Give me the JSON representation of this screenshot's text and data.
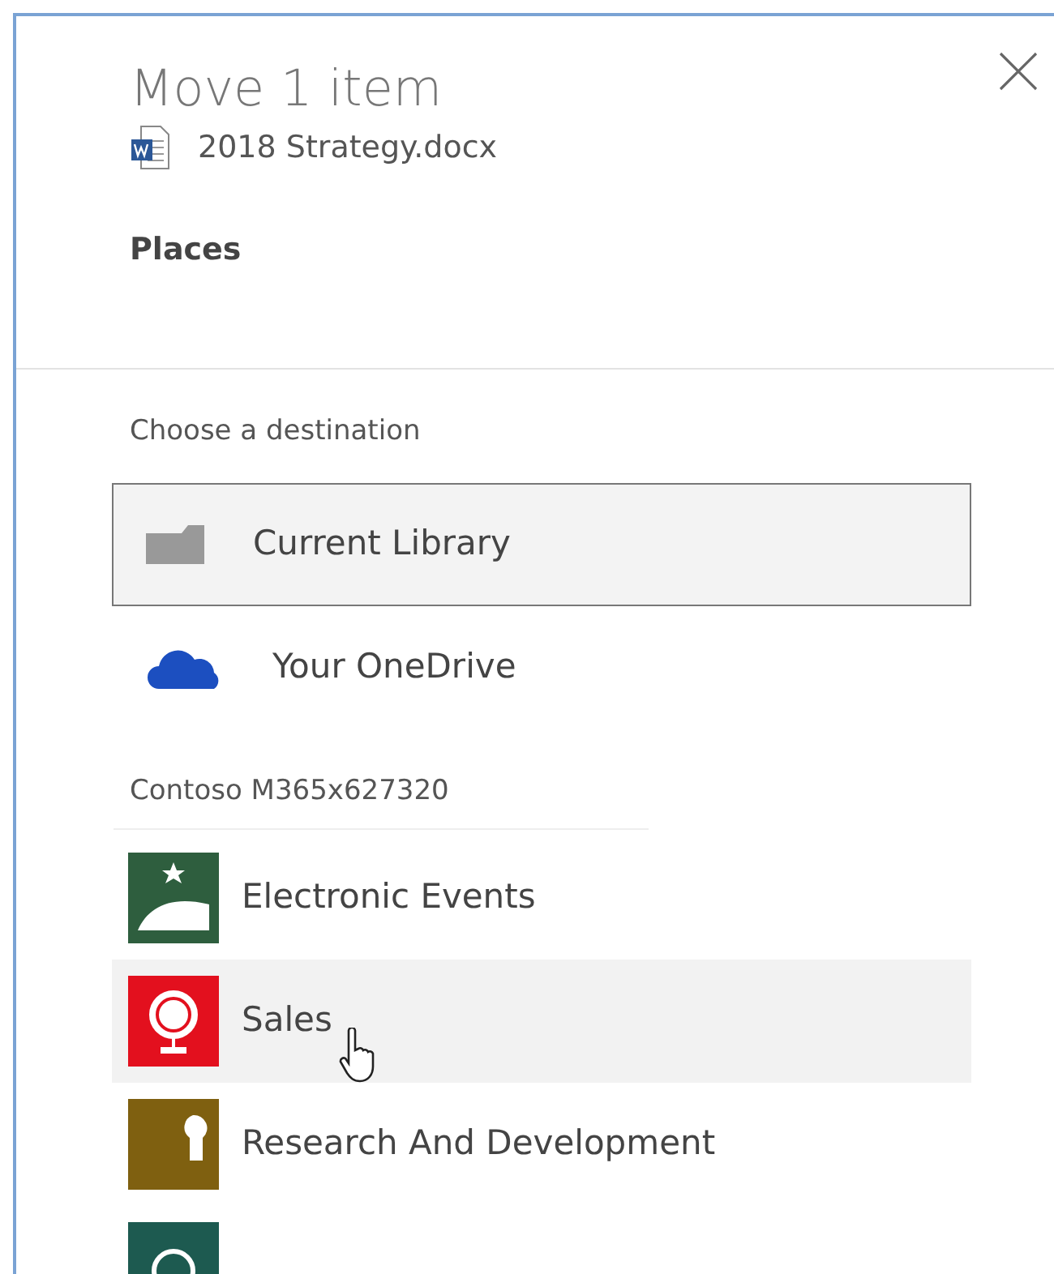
{
  "dialog": {
    "title": "Move 1 item",
    "file_name": "2018 Strategy.docx",
    "section": "Places"
  },
  "destination_label": "Choose a destination",
  "places": [
    {
      "name": "Current Library",
      "kind": "library",
      "selected": true
    },
    {
      "name": "Your OneDrive",
      "kind": "onedrive",
      "selected": false
    }
  ],
  "group_label": "Contoso M365x627320",
  "sites": [
    {
      "name": "Electronic Events",
      "color": "#2e5e3e",
      "hovered": false
    },
    {
      "name": "Sales",
      "color": "#e3101e",
      "hovered": true
    },
    {
      "name": "Research And Development",
      "color": "#7f6010",
      "hovered": false
    },
    {
      "color": "#1d5a50",
      "hovered": false
    }
  ]
}
